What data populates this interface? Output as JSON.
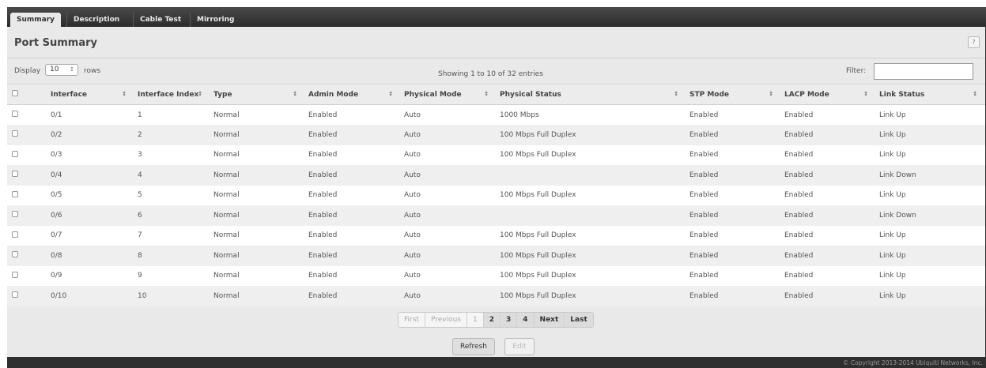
{
  "tabs": [
    {
      "label": "Summary",
      "active": true
    },
    {
      "label": "Description",
      "active": false
    },
    {
      "label": "Cable Test",
      "active": false
    },
    {
      "label": "Mirroring",
      "active": false
    }
  ],
  "page_title": "Port Summary",
  "help_label": "?",
  "display": {
    "label": "Display",
    "value": "10",
    "suffix": "rows"
  },
  "showing": "Showing 1 to 10 of 32 entries",
  "filter": {
    "label": "Filter:",
    "value": ""
  },
  "table": {
    "headers": [
      "Interface",
      "Interface Index",
      "Type",
      "Admin Mode",
      "Physical Mode",
      "Physical Status",
      "STP Mode",
      "LACP Mode",
      "Link Status"
    ],
    "rows": [
      [
        "0/1",
        "1",
        "Normal",
        "Enabled",
        "Auto",
        "1000 Mbps",
        "Enabled",
        "Enabled",
        "Link Up"
      ],
      [
        "0/2",
        "2",
        "Normal",
        "Enabled",
        "Auto",
        "100 Mbps Full Duplex",
        "Enabled",
        "Enabled",
        "Link Up"
      ],
      [
        "0/3",
        "3",
        "Normal",
        "Enabled",
        "Auto",
        "100 Mbps Full Duplex",
        "Enabled",
        "Enabled",
        "Link Up"
      ],
      [
        "0/4",
        "4",
        "Normal",
        "Enabled",
        "Auto",
        "",
        "Enabled",
        "Enabled",
        "Link Down"
      ],
      [
        "0/5",
        "5",
        "Normal",
        "Enabled",
        "Auto",
        "100 Mbps Full Duplex",
        "Enabled",
        "Enabled",
        "Link Up"
      ],
      [
        "0/6",
        "6",
        "Normal",
        "Enabled",
        "Auto",
        "",
        "Enabled",
        "Enabled",
        "Link Down"
      ],
      [
        "0/7",
        "7",
        "Normal",
        "Enabled",
        "Auto",
        "100 Mbps Full Duplex",
        "Enabled",
        "Enabled",
        "Link Up"
      ],
      [
        "0/8",
        "8",
        "Normal",
        "Enabled",
        "Auto",
        "100 Mbps Full Duplex",
        "Enabled",
        "Enabled",
        "Link Up"
      ],
      [
        "0/9",
        "9",
        "Normal",
        "Enabled",
        "Auto",
        "100 Mbps Full Duplex",
        "Enabled",
        "Enabled",
        "Link Up"
      ],
      [
        "0/10",
        "10",
        "Normal",
        "Enabled",
        "Auto",
        "100 Mbps Full Duplex",
        "Enabled",
        "Enabled",
        "Link Up"
      ]
    ]
  },
  "pager": {
    "first": "First",
    "previous": "Previous",
    "pages": [
      "1",
      "2",
      "3",
      "4"
    ],
    "current": "1",
    "next": "Next",
    "last": "Last"
  },
  "buttons": {
    "refresh": "Refresh",
    "edit": "Edit"
  },
  "copyright": "© Copyright 2013-2014 Ubiquiti Networks, Inc.",
  "icons": {
    "sort": "sort-icon",
    "help": "help-icon",
    "select-arrow": "chevron-updown-icon"
  }
}
